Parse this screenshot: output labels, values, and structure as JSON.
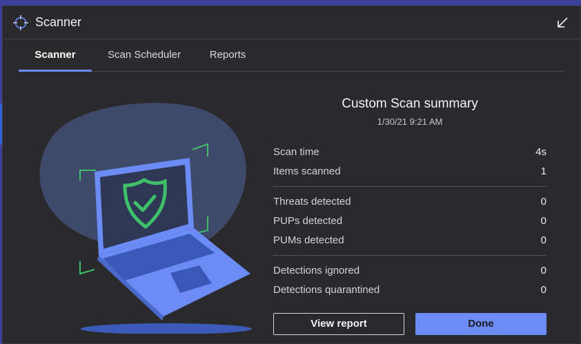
{
  "window": {
    "title": "Scanner",
    "icons": {
      "app": "crosshair-icon",
      "collapse": "collapse-arrow-icon"
    }
  },
  "tabs": [
    {
      "label": "Scanner",
      "active": true
    },
    {
      "label": "Scan Scheduler",
      "active": false
    },
    {
      "label": "Reports",
      "active": false
    }
  ],
  "summary": {
    "title": "Custom Scan summary",
    "date": "1/30/21 9:21 AM",
    "groups": [
      [
        {
          "label": "Scan time",
          "value": "4s"
        },
        {
          "label": "Items scanned",
          "value": "1"
        }
      ],
      [
        {
          "label": "Threats detected",
          "value": "0"
        },
        {
          "label": "PUPs detected",
          "value": "0"
        },
        {
          "label": "PUMs detected",
          "value": "0"
        }
      ],
      [
        {
          "label": "Detections ignored",
          "value": "0"
        },
        {
          "label": "Detections quarantined",
          "value": "0"
        }
      ]
    ]
  },
  "buttons": {
    "view_report": "View report",
    "done": "Done"
  },
  "colors": {
    "accent": "#6b8cf5",
    "success": "#3fbf6a",
    "background": "#2a2a2c"
  }
}
